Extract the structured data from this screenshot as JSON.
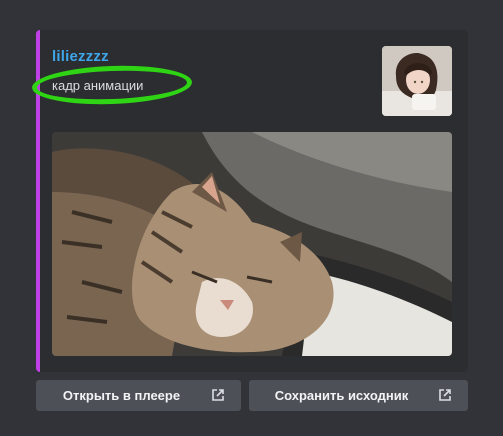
{
  "embed": {
    "author": "liliezzzz",
    "description": "кадр анимации",
    "accent_color": "#c13fe6",
    "annotation_color": "#2fd414"
  },
  "actions": {
    "open_player": "Открыть в плеере",
    "save_source": "Сохранить исходник",
    "icon": "external-link-icon"
  }
}
